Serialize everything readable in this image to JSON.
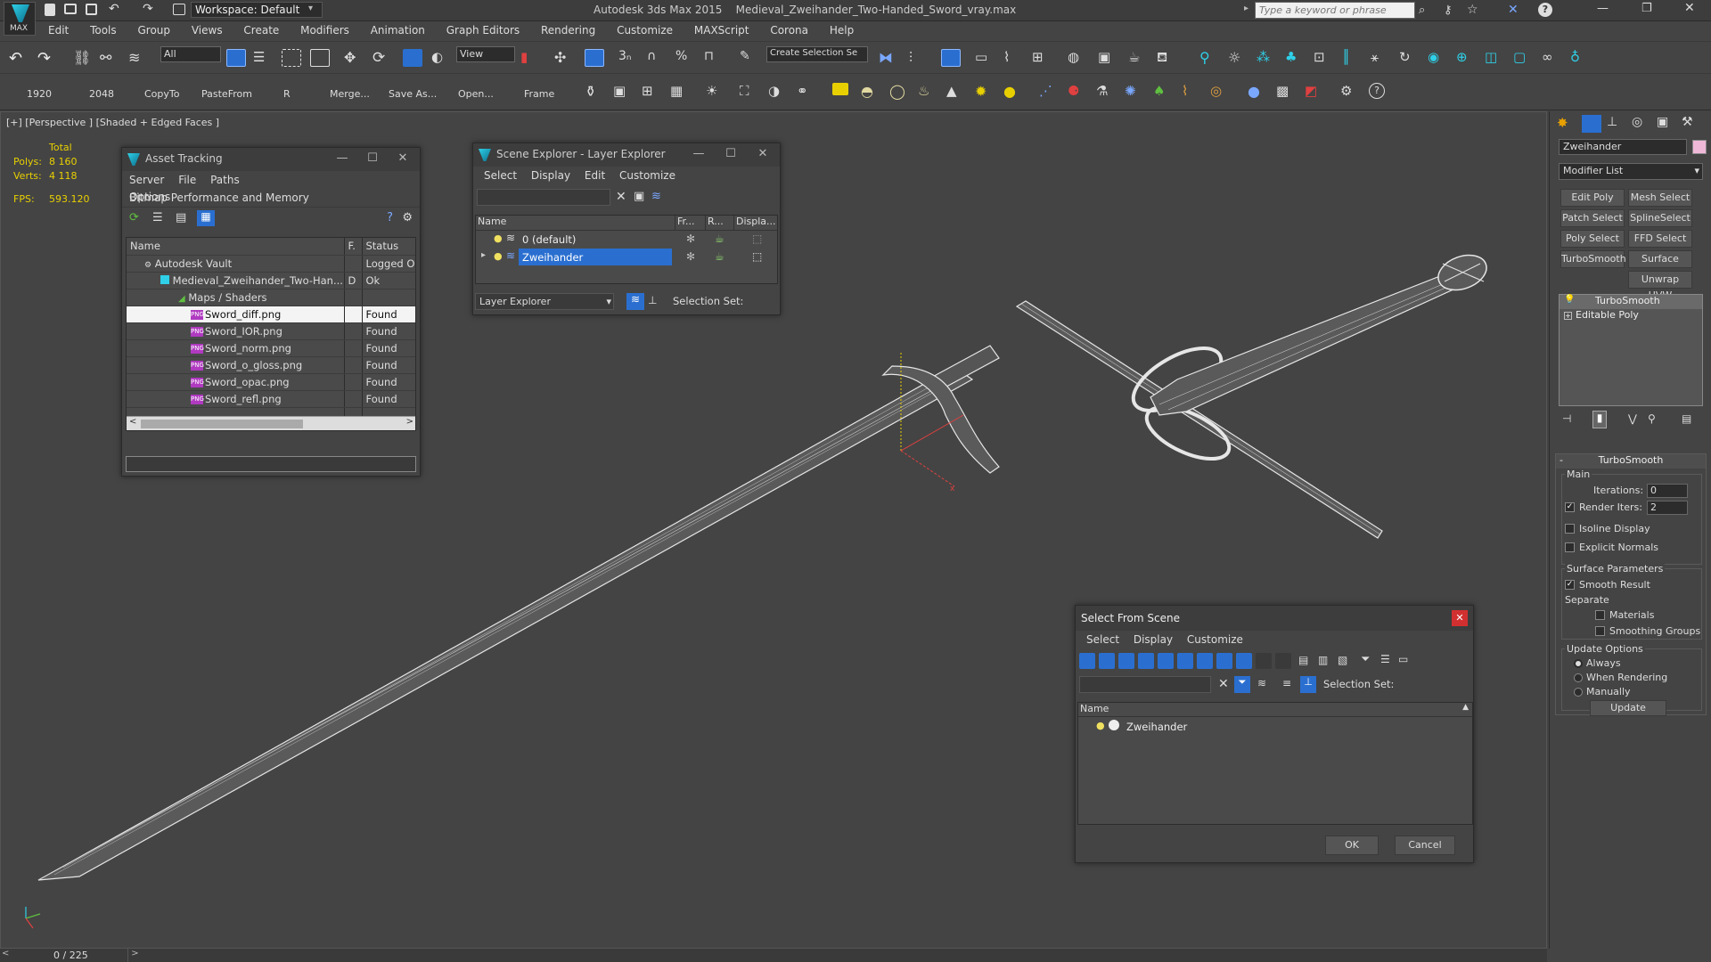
{
  "titlebar": {
    "workspace": "Workspace: Default",
    "app_name": "Autodesk 3ds Max  2015",
    "file_name": "Medieval_Zweihander_Two-Handed_Sword_vray.max",
    "search_placeholder": "Type a keyword or phrase",
    "logo_text": "MAX"
  },
  "menu": [
    "Edit",
    "Tools",
    "Group",
    "Views",
    "Create",
    "Modifiers",
    "Animation",
    "Graph Editors",
    "Rendering",
    "Customize",
    "MAXScript",
    "Corona",
    "Help"
  ],
  "toolbar1": {
    "filter_all": "All",
    "ref_coord": "View",
    "selection_set": "Create Selection Se"
  },
  "toolbar2": {
    "labels": [
      "1920",
      "2048",
      "CopyTo",
      "PasteFrom",
      "R",
      "Merge...",
      "Save As...",
      "Open...",
      "Frame"
    ]
  },
  "viewport": {
    "label": "[+] [Perspective ] [Shaded + Edged Faces ]",
    "stats": {
      "total_label": "Total",
      "polys_label": "Polys:",
      "polys": "8 160",
      "verts_label": "Verts:",
      "verts": "4 118",
      "fps_label": "FPS:",
      "fps": "593.120"
    }
  },
  "asset_tracking": {
    "title": "Asset Tracking",
    "menu": [
      "Server",
      "File",
      "Paths",
      "Bitmap Performance and Memory",
      "Options"
    ],
    "columns": [
      "Name",
      "F.",
      "Status"
    ],
    "rows": [
      {
        "name": "Autodesk Vault",
        "f": "",
        "status": "Logged Ou"
      },
      {
        "name": "Medieval_Zweihander_Two-Han...",
        "f": "D",
        "status": "Ok"
      },
      {
        "name": "Maps / Shaders",
        "f": "",
        "status": ""
      },
      {
        "name": "Sword_diff.png",
        "f": "",
        "status": "Found"
      },
      {
        "name": "Sword_IOR.png",
        "f": "",
        "status": "Found"
      },
      {
        "name": "Sword_norm.png",
        "f": "",
        "status": "Found"
      },
      {
        "name": "Sword_o_gloss.png",
        "f": "",
        "status": "Found"
      },
      {
        "name": "Sword_opac.png",
        "f": "",
        "status": "Found"
      },
      {
        "name": "Sword_refl.png",
        "f": "",
        "status": "Found"
      }
    ],
    "png_badge": "PNG"
  },
  "scene_explorer": {
    "title": "Scene Explorer - Layer Explorer",
    "menu": [
      "Select",
      "Display",
      "Edit",
      "Customize"
    ],
    "columns": [
      "Name",
      "Fr...",
      "R...",
      "Displa..."
    ],
    "layers": [
      "0 (default)",
      "Zweihander"
    ],
    "footer_dropdown": "Layer Explorer",
    "selection_set_label": "Selection Set:"
  },
  "select_from_scene": {
    "title": "Select From Scene",
    "menu": [
      "Select",
      "Display",
      "Customize"
    ],
    "selection_set_label": "Selection Set:",
    "column": "Name",
    "items": [
      "Zweihander"
    ],
    "ok": "OK",
    "cancel": "Cancel"
  },
  "command_panel": {
    "object_name": "Zweihander",
    "object_color": "#f0b8d8",
    "modifier_list": "Modifier List",
    "buttons": [
      "Edit Poly",
      "Mesh Select",
      "Patch Select",
      "SplineSelect",
      "Poly Select",
      "FFD Select",
      "TurboSmooth",
      "Surface Select",
      "Unwrap UVW"
    ],
    "stack": [
      "TurboSmooth",
      "Editable Poly"
    ],
    "rollout_title": "TurboSmooth",
    "main_label": "Main",
    "iterations_label": "Iterations:",
    "iterations": "0",
    "render_iters_label": "Render Iters:",
    "render_iters": "2",
    "isoline": "Isoline Display",
    "explicit_normals": "Explicit Normals",
    "surface_params": "Surface Parameters",
    "smooth_result": "Smooth Result",
    "separate": "Separate",
    "materials": "Materials",
    "smoothing_groups": "Smoothing Groups",
    "update_options": "Update Options",
    "always": "Always",
    "when_rendering": "When Rendering",
    "manually": "Manually",
    "update_btn": "Update"
  },
  "timeline": {
    "frame": "0 / 225"
  },
  "colors": {
    "accent_blue": "#2a6fd0",
    "stats_yellow": "#e8d000",
    "wire": "#e0e0e0"
  }
}
